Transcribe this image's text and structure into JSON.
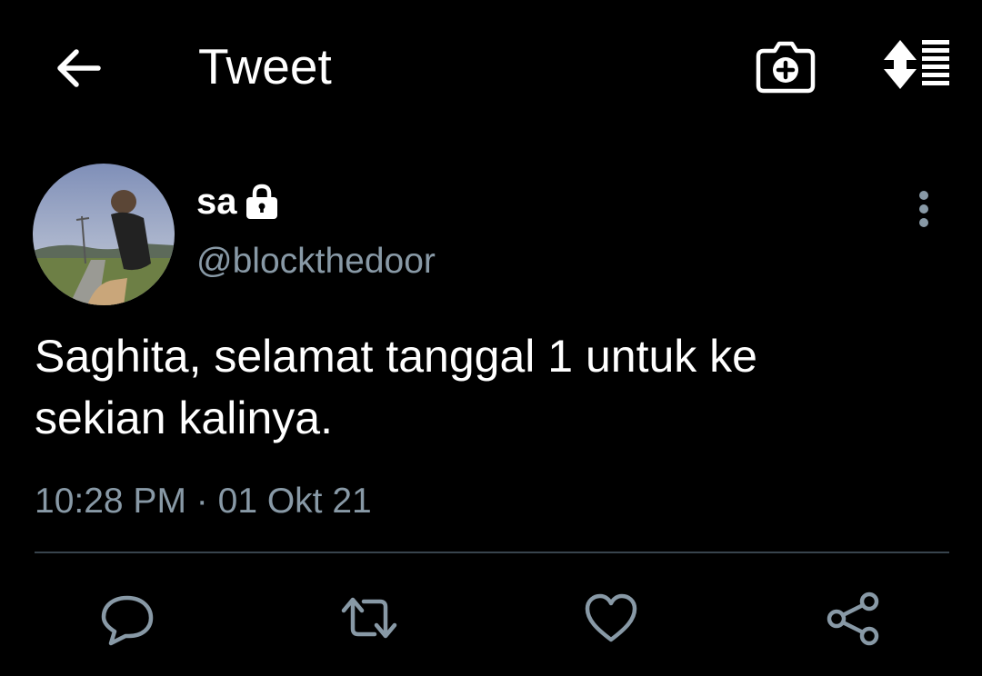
{
  "header": {
    "title": "Tweet",
    "back_icon": "arrow-left-icon",
    "camera_icon": "camera-add-icon",
    "sort_icon": "sort-list-icon"
  },
  "tweet": {
    "display_name": "sa",
    "protected_icon": "lock-icon",
    "handle": "@blockthedoor",
    "text_line1": "Saghita, selamat tanggal 1 untuk ke",
    "text_line2": "sekian kalinya.",
    "time": "10:28 PM",
    "separator": "·",
    "date": "01 Okt 21"
  },
  "actions": [
    {
      "name": "reply",
      "icon": "speech-bubble-icon"
    },
    {
      "name": "retweet",
      "icon": "retweet-icon"
    },
    {
      "name": "like",
      "icon": "heart-icon"
    },
    {
      "name": "share",
      "icon": "share-icon"
    }
  ],
  "colors": {
    "background": "#000000",
    "text_primary": "#ffffff",
    "text_secondary": "#8899a6",
    "divider": "#38444d"
  }
}
